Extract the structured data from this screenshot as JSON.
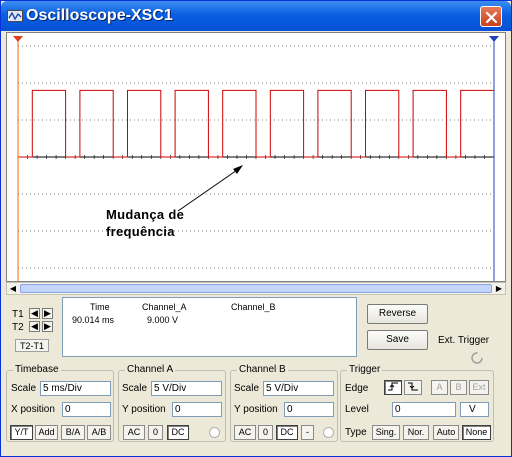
{
  "window": {
    "title": "Oscilloscope-XSC1"
  },
  "annotation": {
    "line1": "Mudança de",
    "line2": "frequência"
  },
  "cursors": {
    "t1": "T1",
    "t2": "T2",
    "t2_t1": "T2-T1"
  },
  "readout": {
    "headers": [
      "Time",
      "Channel_A",
      "Channel_B"
    ],
    "row": {
      "time": "90.014 ms",
      "channel_a": "9.000 V",
      "channel_b": ""
    }
  },
  "buttons": {
    "reverse": "Reverse",
    "save": "Save",
    "ext_trigger": "Ext. Trigger"
  },
  "timebase": {
    "title": "Timebase",
    "scale_label": "Scale",
    "scale_value": "5 ms/Div",
    "xpos_label": "X position",
    "xpos_value": "0",
    "modes": [
      "Y/T",
      "Add",
      "B/A",
      "A/B"
    ]
  },
  "channel_a": {
    "title": "Channel A",
    "scale_label": "Scale",
    "scale_value": "5  V/Div",
    "ypos_label": "Y position",
    "ypos_value": "0",
    "coupling": [
      "AC",
      "0",
      "DC"
    ]
  },
  "channel_b": {
    "title": "Channel B",
    "scale_label": "Scale",
    "scale_value": "5  V/Div",
    "ypos_label": "Y position",
    "ypos_value": "0",
    "coupling": [
      "AC",
      "0",
      "DC",
      "-"
    ]
  },
  "trigger": {
    "title": "Trigger",
    "edge_label": "Edge",
    "sources": [
      "A",
      "B",
      "Ext"
    ],
    "level_label": "Level",
    "level_value": "0",
    "level_unit": "V",
    "type_label": "Type",
    "types": [
      "Sing.",
      "Nor.",
      "Auto",
      "None"
    ]
  },
  "waveform": {
    "channel": "A",
    "amplitude_v": 9.0,
    "volts_per_div": 5,
    "ms_per_div": 5,
    "color": "#d00000",
    "low_segment_ms": 1.5,
    "high_segment_ms": [
      3.5,
      2.2
    ],
    "frequency_change_ms": 56
  },
  "colors": {
    "titlebar": "#0a5fe0",
    "trace": "#d00000",
    "cursor1": "#e04020",
    "cursor2": "#2040c0"
  }
}
